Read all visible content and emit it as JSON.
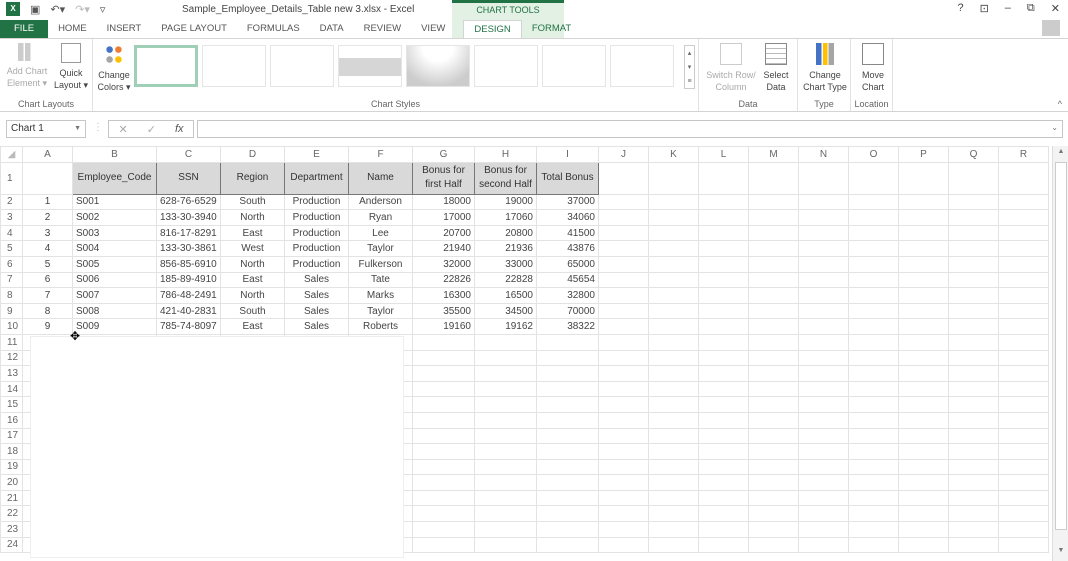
{
  "titlebar": {
    "window_title": "Sample_Employee_Details_Table new 3.xlsx - Excel",
    "context_tab_group": "CHART TOOLS",
    "qat_icons": [
      "excel-logo-icon",
      "save-icon",
      "undo-icon",
      "redo-icon",
      "customize-qat-icon"
    ],
    "window_controls": {
      "help": "?",
      "ribbon_display": "⊡",
      "minimize": "–",
      "restore": "⧉",
      "close": "✕"
    }
  },
  "tabs": [
    "FILE",
    "HOME",
    "INSERT",
    "PAGE LAYOUT",
    "FORMULAS",
    "DATA",
    "REVIEW",
    "VIEW",
    "DESIGN",
    "FORMAT"
  ],
  "active_tab": "DESIGN",
  "ribbon": {
    "chart_layouts": {
      "label": "Chart Layouts",
      "add_chart_element": "Add Chart Element ▾",
      "add_chart_element_l1": "Add Chart",
      "add_chart_element_l2": "Element ▾",
      "quick_layout_l1": "Quick",
      "quick_layout_l2": "Layout ▾"
    },
    "change_colors_l1": "Change",
    "change_colors_l2": "Colors ▾",
    "chart_styles": {
      "label": "Chart Styles",
      "count_visible": 8,
      "selected_index": 0
    },
    "data": {
      "label": "Data",
      "switch_l1": "Switch Row/",
      "switch_l2": "Column",
      "select_l1": "Select",
      "select_l2": "Data"
    },
    "type": {
      "label": "Type",
      "change_l1": "Change",
      "change_l2": "Chart Type"
    },
    "location": {
      "label": "Location",
      "move_l1": "Move",
      "move_l2": "Chart"
    }
  },
  "formula_bar": {
    "name_box": "Chart 1",
    "fx": "fx",
    "cancel": "✕",
    "enter": "✓",
    "content": ""
  },
  "sheet": {
    "columns": [
      "A",
      "B",
      "C",
      "D",
      "E",
      "F",
      "G",
      "H",
      "I",
      "J",
      "K",
      "L",
      "M",
      "N",
      "O",
      "P",
      "Q",
      "R"
    ],
    "headers": [
      "",
      "Employee_Code",
      "SSN",
      "Region",
      "Department",
      "Name",
      "Bonus for first Half",
      "Bonus for second Half",
      "Total Bonus"
    ],
    "rows": [
      [
        "1",
        "S001",
        "628-76-6529",
        "South",
        "Production",
        "Anderson",
        "18000",
        "19000",
        "37000"
      ],
      [
        "2",
        "S002",
        "133-30-3940",
        "North",
        "Production",
        "Ryan",
        "17000",
        "17060",
        "34060"
      ],
      [
        "3",
        "S003",
        "816-17-8291",
        "East",
        "Production",
        "Lee",
        "20700",
        "20800",
        "41500"
      ],
      [
        "4",
        "S004",
        "133-30-3861",
        "West",
        "Production",
        "Taylor",
        "21940",
        "21936",
        "43876"
      ],
      [
        "5",
        "S005",
        "856-85-6910",
        "North",
        "Production",
        "Fulkerson",
        "32000",
        "33000",
        "65000"
      ],
      [
        "6",
        "S006",
        "185-89-4910",
        "East",
        "Sales",
        "Tate",
        "22826",
        "22828",
        "45654"
      ],
      [
        "7",
        "S007",
        "786-48-2491",
        "North",
        "Sales",
        "Marks",
        "16300",
        "16500",
        "32800"
      ],
      [
        "8",
        "S008",
        "421-40-2831",
        "South",
        "Sales",
        "Taylor",
        "35500",
        "34500",
        "70000"
      ],
      [
        "9",
        "S009",
        "785-74-8097",
        "East",
        "Sales",
        "Roberts",
        "19160",
        "19162",
        "38322"
      ]
    ],
    "row_numbers": [
      "1",
      "2",
      "3",
      "4",
      "5",
      "6",
      "7",
      "8",
      "9",
      "10",
      "11",
      "12",
      "13",
      "14",
      "15",
      "16",
      "17",
      "18",
      "19",
      "20",
      "21",
      "22",
      "23",
      "24"
    ]
  },
  "chart": {
    "name": "Chart 1",
    "state": "empty"
  }
}
